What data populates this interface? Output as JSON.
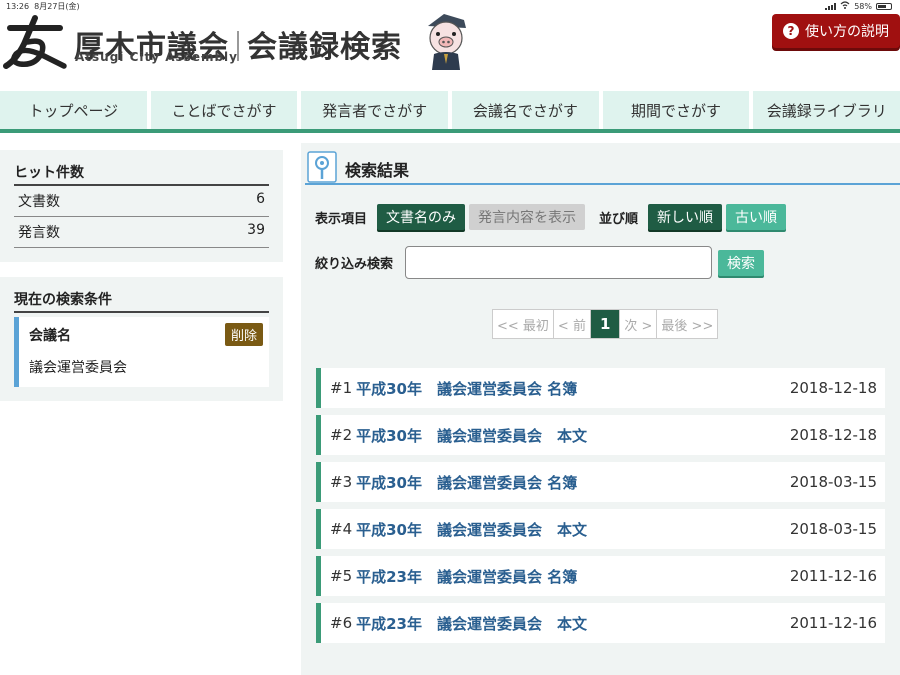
{
  "status_bar": {
    "time": "13:26",
    "date": "8月27日(金)",
    "battery": "58%"
  },
  "header": {
    "title_main": "厚木市議会",
    "title_sub": "会議録検索",
    "subtitle": "Atsugi City Assembly",
    "help_label": "使い方の説明",
    "help_icon": "question-icon",
    "accent_color": "#a01010"
  },
  "nav": {
    "tabs": [
      "トップページ",
      "ことばでさがす",
      "発言者でさがす",
      "会議名でさがす",
      "期間でさがす",
      "会議録ライブラリ"
    ]
  },
  "hits": {
    "heading": "ヒット件数",
    "rows": [
      {
        "label": "文書数",
        "value": "6"
      },
      {
        "label": "発言数",
        "value": "39"
      }
    ]
  },
  "conditions": {
    "heading": "現在の検索条件",
    "name": "会議名",
    "value": "議会運営委員会",
    "delete_label": "削除"
  },
  "results": {
    "heading": "検索結果",
    "display_label": "表示項目",
    "display_options": [
      "文書名のみ",
      "発言内容を表示"
    ],
    "sort_label": "並び順",
    "sort_options": [
      "新しい順",
      "古い順"
    ],
    "filter_label": "絞り込み検索",
    "filter_value": "",
    "filter_placeholder": "",
    "search_label": "検索",
    "pager": {
      "first": "<< 最初",
      "prev": "< 前",
      "current": "1",
      "next": "次 >",
      "last": "最後 >>"
    },
    "items": [
      {
        "num": "#1",
        "title": "平成30年　議会運営委員会 名簿",
        "date": "2018-12-18"
      },
      {
        "num": "#2",
        "title": "平成30年　議会運営委員会　本文",
        "date": "2018-12-18"
      },
      {
        "num": "#3",
        "title": "平成30年　議会運営委員会 名簿",
        "date": "2018-03-15"
      },
      {
        "num": "#4",
        "title": "平成30年　議会運営委員会　本文",
        "date": "2018-03-15"
      },
      {
        "num": "#5",
        "title": "平成23年　議会運営委員会 名簿",
        "date": "2011-12-16"
      },
      {
        "num": "#6",
        "title": "平成23年　議会運営委員会　本文",
        "date": "2011-12-16"
      }
    ]
  },
  "colors": {
    "nav_bg": "#dff3ee",
    "green_dark": "#1f5c44",
    "teal": "#4bb89a",
    "link": "#2a5f90",
    "border_blue": "#5ba3d6"
  }
}
